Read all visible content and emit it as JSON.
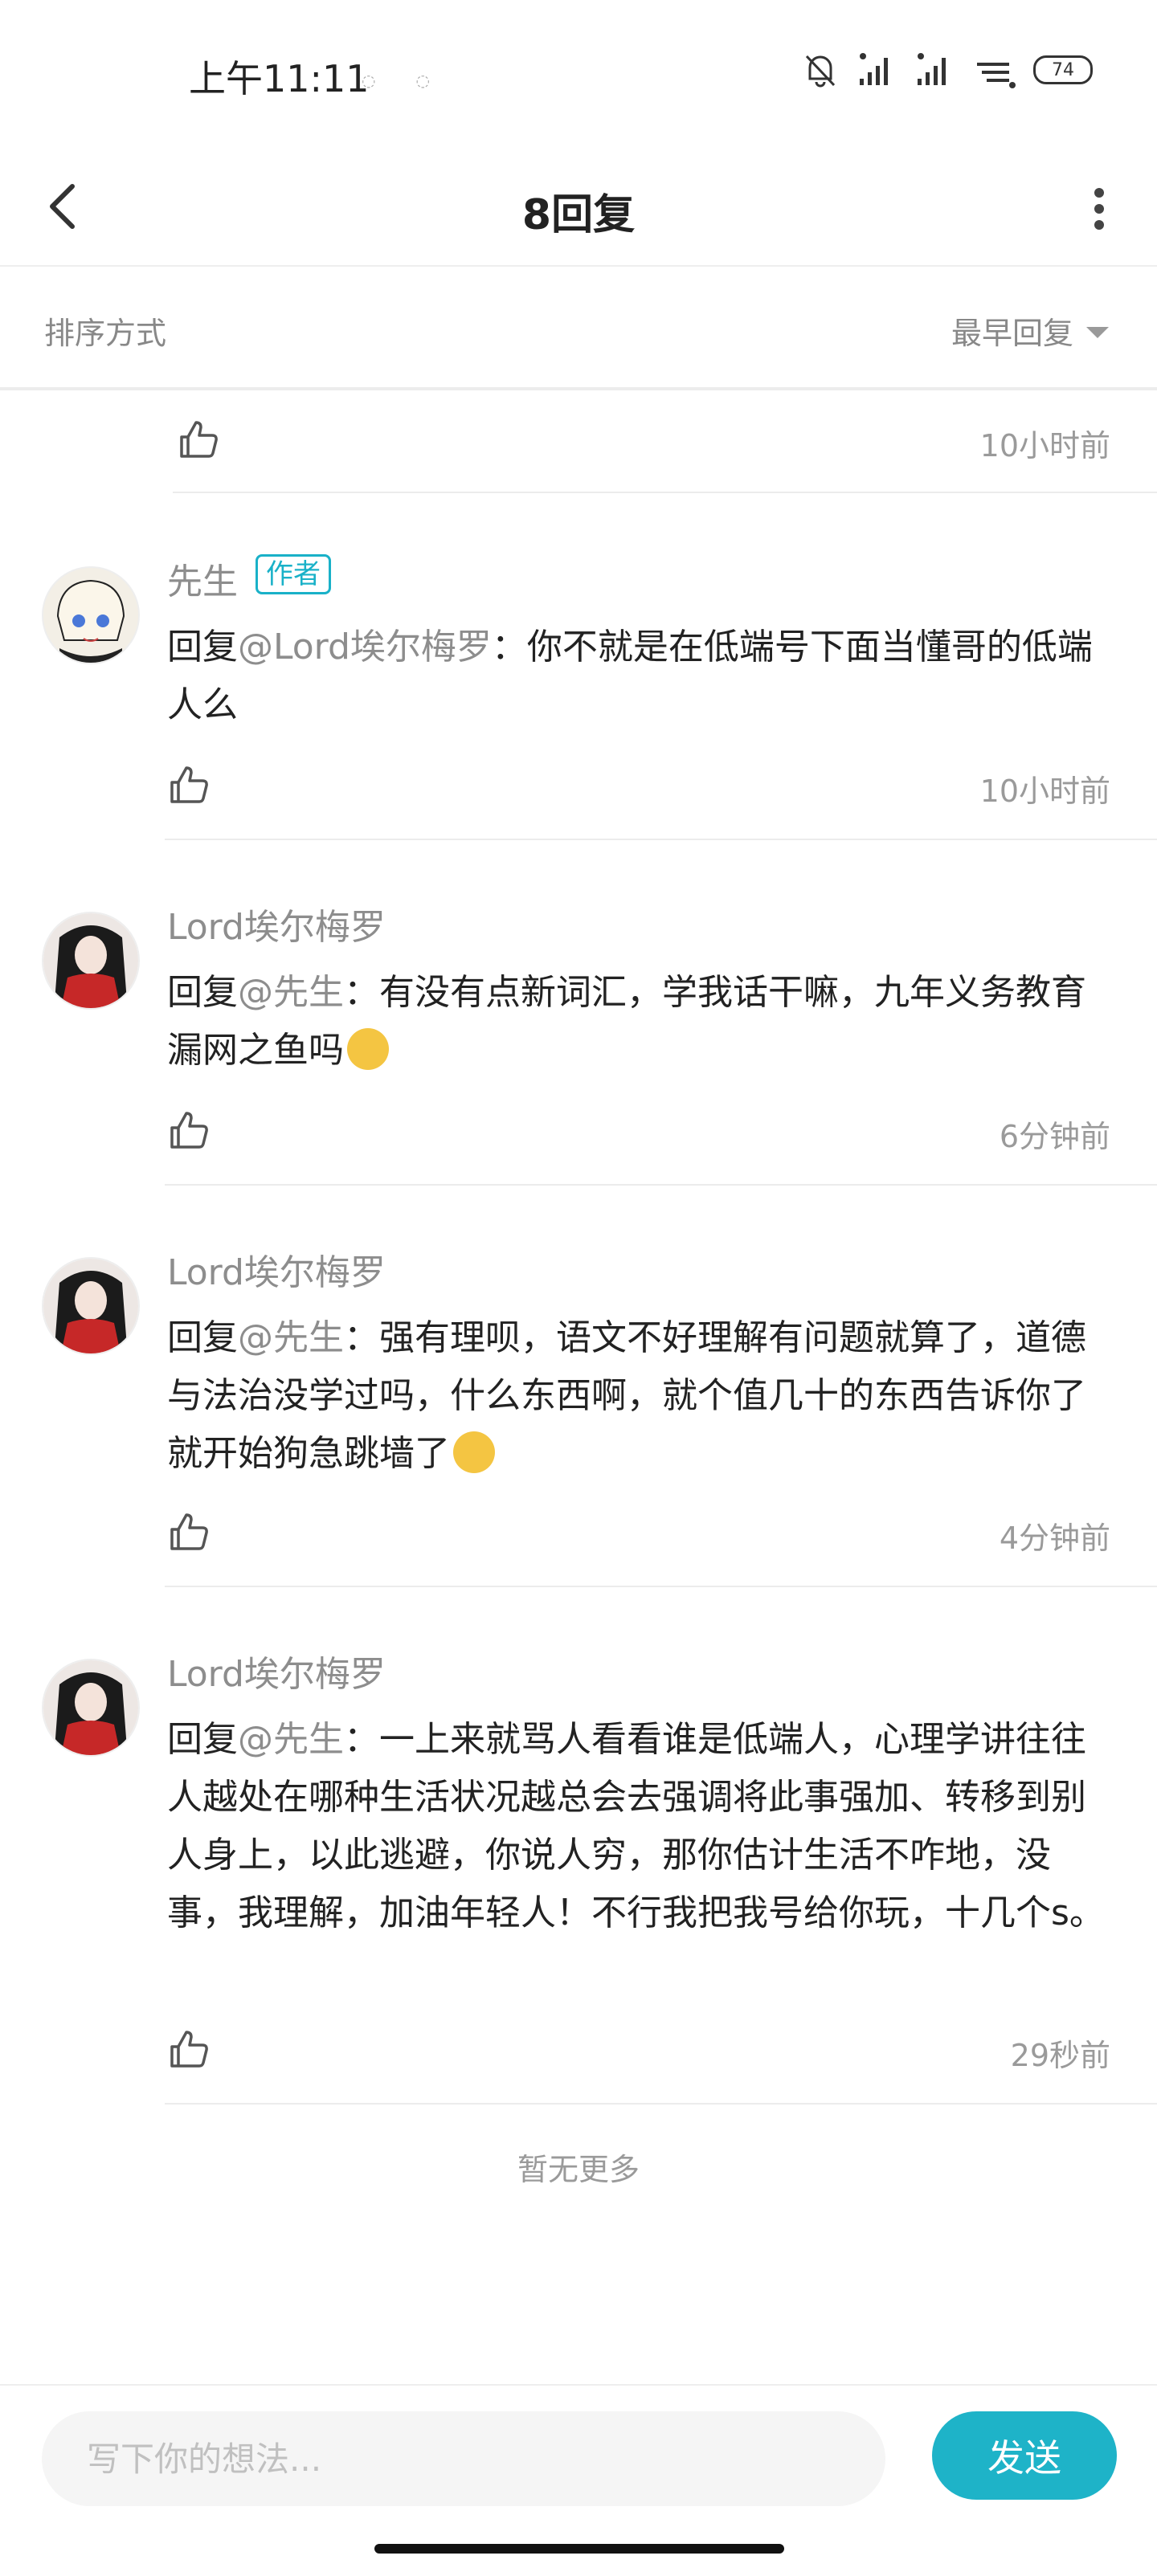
{
  "status_bar": {
    "time": "上午11:11",
    "battery": "74"
  },
  "nav": {
    "title": "8回复"
  },
  "sort": {
    "label": "排序方式",
    "value": "最早回复"
  },
  "top_item": {
    "timestamp": "10小时前"
  },
  "comments": [
    {
      "name": "先生",
      "badge": "作者",
      "reply_prefix": "回复",
      "mention": "@Lord埃尔梅罗",
      "text": "：你不就是在低端号下面当懂哥的低端人么",
      "timestamp": "10小时前"
    },
    {
      "name": "Lord埃尔梅罗",
      "reply_prefix": "回复",
      "mention": "@先生",
      "text": "：有没有点新词汇，学我话干嘛，九年义务教育漏网之鱼吗",
      "timestamp": "6分钟前"
    },
    {
      "name": "Lord埃尔梅罗",
      "reply_prefix": "回复",
      "mention": "@先生",
      "text": "：强有理呗，语文不好理解有问题就算了，道德与法治没学过吗，什么东西啊，就个值几十的东西告诉你了就开始狗急跳墙了",
      "timestamp": "4分钟前"
    },
    {
      "name": "Lord埃尔梅罗",
      "reply_prefix": "回复",
      "mention": "@先生",
      "text": "：一上来就骂人看看谁是低端人，心理学讲往往人越处在哪种生活状况越总会去强调将此事强加、转移到别人身上，以此逃避，你说人穷，那你估计生活不咋地，没事，我理解，加油年轻人！不行我把我号给你玩，十几个s。",
      "timestamp": "29秒前"
    }
  ],
  "footer": {
    "no_more": "暂无更多"
  },
  "composer": {
    "placeholder": "写下你的想法...",
    "send_label": "发送"
  },
  "colors": {
    "accent": "#1eb3c8",
    "muted_text": "#8d8d8d"
  }
}
